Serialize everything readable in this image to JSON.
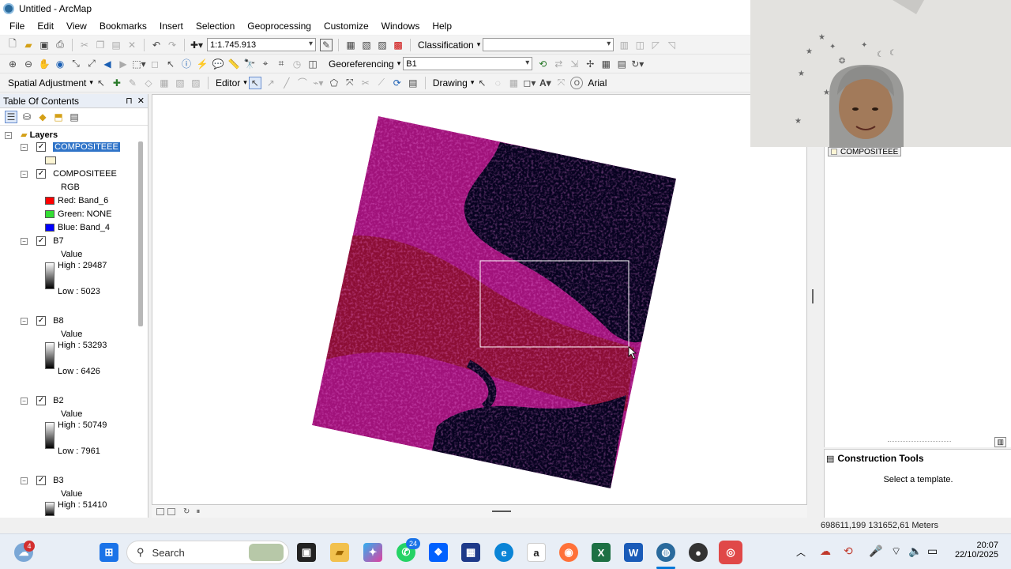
{
  "window": {
    "title": "Untitled - ArcMap"
  },
  "menu": [
    "File",
    "Edit",
    "View",
    "Bookmarks",
    "Insert",
    "Selection",
    "Geoprocessing",
    "Customize",
    "Windows",
    "Help"
  ],
  "toolbar1": {
    "scale_value": "1:1.745.913",
    "classification_label": "Classification",
    "classification_value": ""
  },
  "toolbar2": {
    "georeferencing_label": "Georeferencing",
    "layer_value": "B1"
  },
  "toolbar3": {
    "spatial_adjustment_label": "Spatial Adjustment",
    "editor_label": "Editor",
    "drawing_label": "Drawing",
    "font_value": "Arial"
  },
  "toc": {
    "title": "Table Of Contents",
    "root": "Layers",
    "layers": [
      {
        "name": "COMPOSITEEE",
        "selected": true
      },
      {
        "name": "COMPOSITEEE",
        "sub": "RGB",
        "red": "Red:   Band_6",
        "green": "Green: NONE",
        "blue": "Blue:  Band_4"
      },
      {
        "name": "B7",
        "value": "Value",
        "high": "High : 29487",
        "low": "Low : 5023"
      },
      {
        "name": "B8",
        "value": "Value",
        "high": "High : 53293",
        "low": "Low : 6426"
      },
      {
        "name": "B2",
        "value": "Value",
        "high": "High : 50749",
        "low": "Low : 7961"
      },
      {
        "name": "B3",
        "value": "Value",
        "high": "High : 51410"
      }
    ]
  },
  "right_panel": {
    "layer_chip": "COMPOSITEEE"
  },
  "construction_tools": {
    "title": "Construction Tools",
    "hint": "Select a template."
  },
  "status": {
    "coordinates": "698611,199  131652,61 Meters"
  },
  "taskbar": {
    "search_placeholder": "Search",
    "time": "20:07",
    "date": "22/10/2025",
    "badge_left": "4",
    "badge_whatsapp": "24"
  },
  "colors": {
    "raster_magenta": "#a0127a",
    "raster_red": "#8a0e2e",
    "water": "#070320",
    "accent": "#0078d7"
  }
}
